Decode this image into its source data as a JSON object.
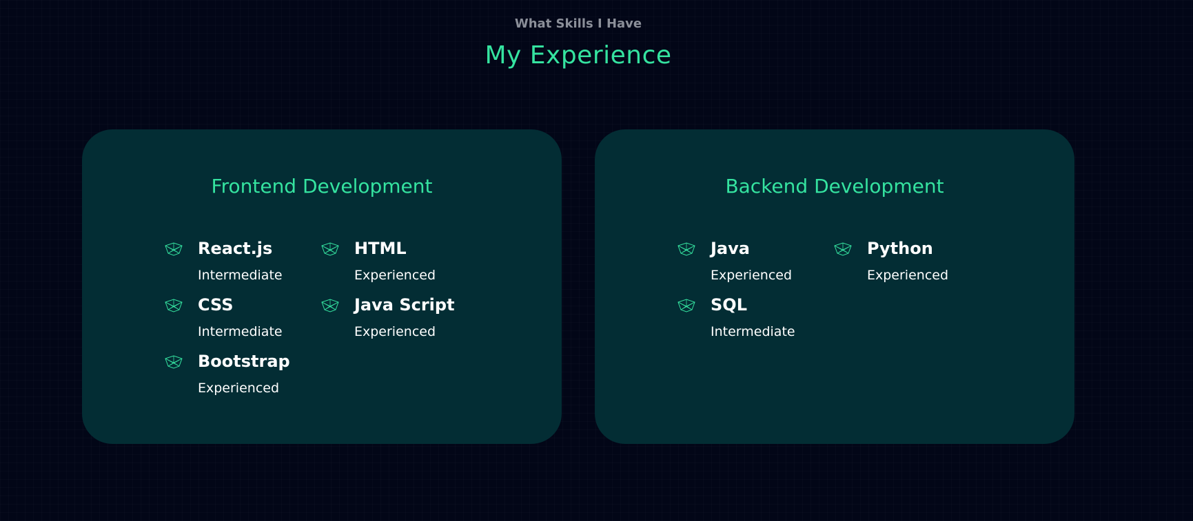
{
  "header": {
    "subtitle": "What Skills I Have",
    "title": "My Experience"
  },
  "colors": {
    "background": "#020617",
    "card": "#032d34",
    "accent": "#35e3a0",
    "muted": "#8b8f99",
    "text": "#ffffff"
  },
  "frontend": {
    "title": "Frontend Development",
    "skills": [
      {
        "name": "React.js",
        "level": "Intermediate",
        "icon": "check-badge-icon"
      },
      {
        "name": "HTML",
        "level": "Experienced",
        "icon": "check-badge-icon"
      },
      {
        "name": "CSS",
        "level": "Intermediate",
        "icon": "check-badge-icon"
      },
      {
        "name": "Java Script",
        "level": "Experienced",
        "icon": "check-badge-icon"
      },
      {
        "name": "Bootstrap",
        "level": "Experienced",
        "icon": "check-badge-icon"
      }
    ]
  },
  "backend": {
    "title": "Backend Development",
    "skills": [
      {
        "name": "Java",
        "level": "Experienced",
        "icon": "check-badge-icon"
      },
      {
        "name": "Python",
        "level": "Experienced",
        "icon": "check-badge-icon"
      },
      {
        "name": "SQL",
        "level": "Intermediate",
        "icon": "check-badge-icon"
      }
    ]
  }
}
